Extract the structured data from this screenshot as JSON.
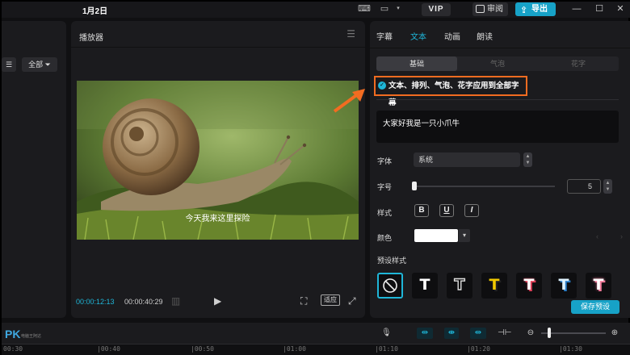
{
  "topbar": {
    "date": "1月2日",
    "vip": "VIP",
    "review": "审阅",
    "export": "导出"
  },
  "left": {
    "filter_all": "全部"
  },
  "player": {
    "title": "播放器",
    "subtitle": "今天我来这里探险",
    "time_current": "00:00:12:13",
    "time_total": "00:00:40:29",
    "fit": "适应"
  },
  "right": {
    "tabs": [
      "字幕",
      "文本",
      "动画",
      "朗读"
    ],
    "active_tab": "文本",
    "subtabs": [
      "基础",
      "气泡",
      "花字"
    ],
    "apply_all": "文本、排列、气泡、花字应用到全部字幕",
    "text_content": "大家好我是一只小爪牛",
    "font_label": "字体",
    "font_value": "系统",
    "size_label": "字号",
    "size_value": "5",
    "size_fraction": 0.0,
    "style_label": "样式",
    "style_buttons": [
      "B",
      "U",
      "I"
    ],
    "color_label": "颜色",
    "color_value": "#ffffff",
    "preset_label": "预设样式",
    "presets": [
      "T",
      "T",
      "T",
      "T",
      "T",
      "T"
    ],
    "preset_colors": [
      "#ffffff",
      "#cccccc",
      "#f0c800",
      "#ffffff",
      "#dff3ff",
      "#ffffff"
    ],
    "save_preset": "保存预设"
  },
  "timeline": {
    "logo": "PK",
    "logo_sub": "电脑王阿达",
    "ticks": [
      "00:30",
      "|00:40",
      "|00:50",
      "|01:00",
      "|01:10",
      "|01:20",
      "|01:30"
    ]
  },
  "colors": {
    "accent": "#1fb6d8",
    "highlight": "#f26c21"
  }
}
